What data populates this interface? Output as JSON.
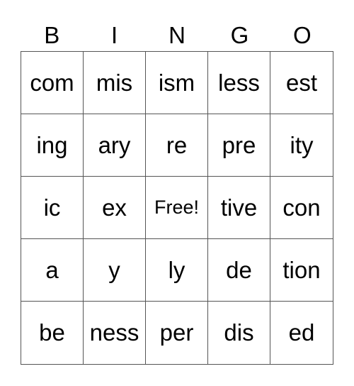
{
  "header": [
    "B",
    "I",
    "N",
    "G",
    "O"
  ],
  "cells": [
    "com",
    "mis",
    "ism",
    "less",
    "est",
    "ing",
    "ary",
    "re",
    "pre",
    "ity",
    "ic",
    "ex",
    "Free!",
    "tive",
    "con",
    "a",
    "y",
    "ly",
    "de",
    "tion",
    "be",
    "ness",
    "per",
    "dis",
    "ed"
  ]
}
